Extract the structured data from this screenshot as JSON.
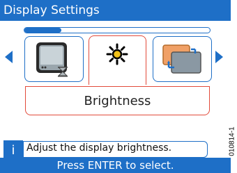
{
  "title": "Display Settings",
  "progress": 0.2,
  "tiles": [
    {
      "name": "display-icon",
      "selected": false
    },
    {
      "name": "brightness-icon",
      "selected": true
    },
    {
      "name": "copy-icon",
      "selected": false
    }
  ],
  "selected_label": "Brightness",
  "info_text": "Adjust the display brightness.",
  "info_icon": "i",
  "status_text": "Press ENTER to select.",
  "figure_code": "010814-1",
  "colors": {
    "accent": "#1e6fc7",
    "selection": "#e24a3a"
  }
}
